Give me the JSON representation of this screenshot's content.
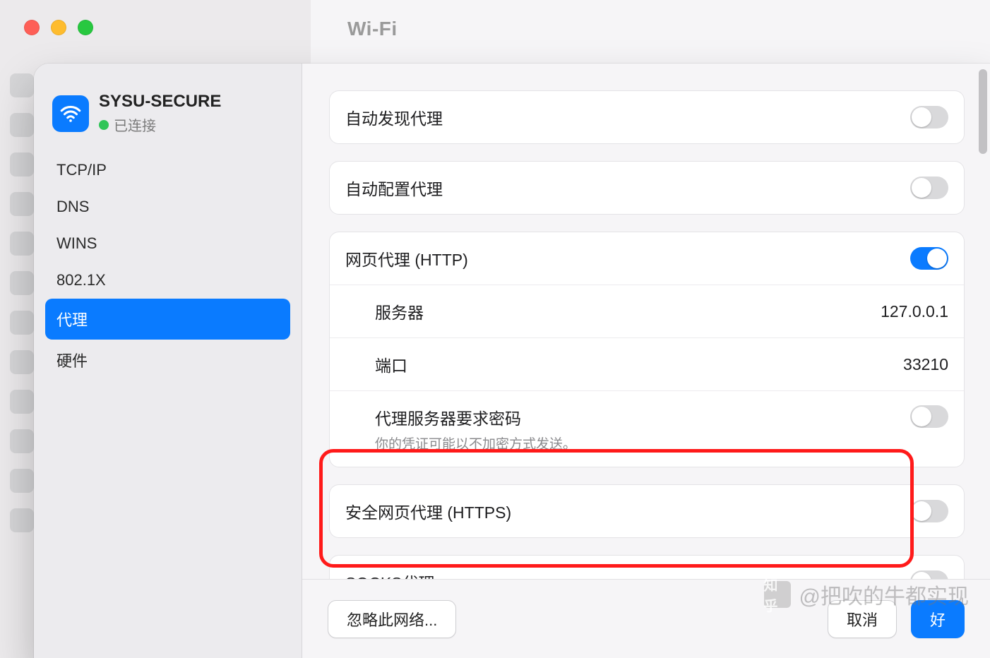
{
  "parent_window": {
    "title": "Wi-Fi"
  },
  "network": {
    "name": "SYSU-SECURE",
    "status_text": "已连接",
    "status_color": "#31c558"
  },
  "sidebar": {
    "items": [
      {
        "label": "TCP/IP"
      },
      {
        "label": "DNS"
      },
      {
        "label": "WINS"
      },
      {
        "label": "802.1X"
      },
      {
        "label": "代理"
      },
      {
        "label": "硬件"
      }
    ],
    "active_index": 4
  },
  "proxy": {
    "auto_discover": {
      "label": "自动发现代理",
      "on": false
    },
    "auto_config": {
      "label": "自动配置代理",
      "on": false
    },
    "http": {
      "label": "网页代理 (HTTP)",
      "on": true,
      "server_label": "服务器",
      "server_value": "127.0.0.1",
      "port_label": "端口",
      "port_value": "33210",
      "auth_label": "代理服务器要求密码",
      "auth_hint": "你的凭证可能以不加密方式发送。",
      "auth_on": false
    },
    "https": {
      "label": "安全网页代理 (HTTPS)",
      "on": false
    },
    "socks": {
      "label": "SOCKS代理",
      "on": false
    }
  },
  "footer": {
    "forget_label": "忽略此网络...",
    "cancel_label": "取消",
    "ok_label": "好"
  },
  "watermark": {
    "text": "@把吹的牛都实现",
    "logo_text": "知乎"
  },
  "colors": {
    "accent": "#0a7bff",
    "annotation": "#ff1a1a"
  }
}
